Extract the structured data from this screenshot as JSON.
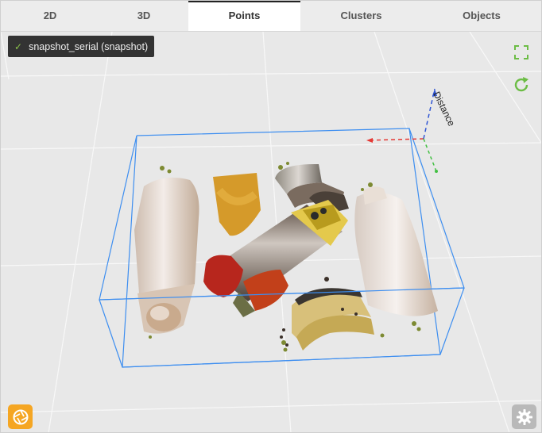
{
  "tabs": [
    {
      "label": "2D"
    },
    {
      "label": "3D"
    },
    {
      "label": "Points",
      "active": true
    },
    {
      "label": "Clusters"
    },
    {
      "label": "Objects"
    }
  ],
  "snapshot": {
    "label": "snapshot_serial (snapshot)",
    "status_icon": "check-icon"
  },
  "viewport": {
    "axis_label": "Distance"
  },
  "icons": {
    "fullscreen": "fullscreen-icon",
    "refresh": "refresh-icon",
    "camera": "camera-shutter-icon",
    "settings": "gear-icon"
  },
  "colors": {
    "accent_green": "#6cbd45",
    "camera_orange": "#f5a623",
    "bbox_blue": "#3d8ef0"
  }
}
